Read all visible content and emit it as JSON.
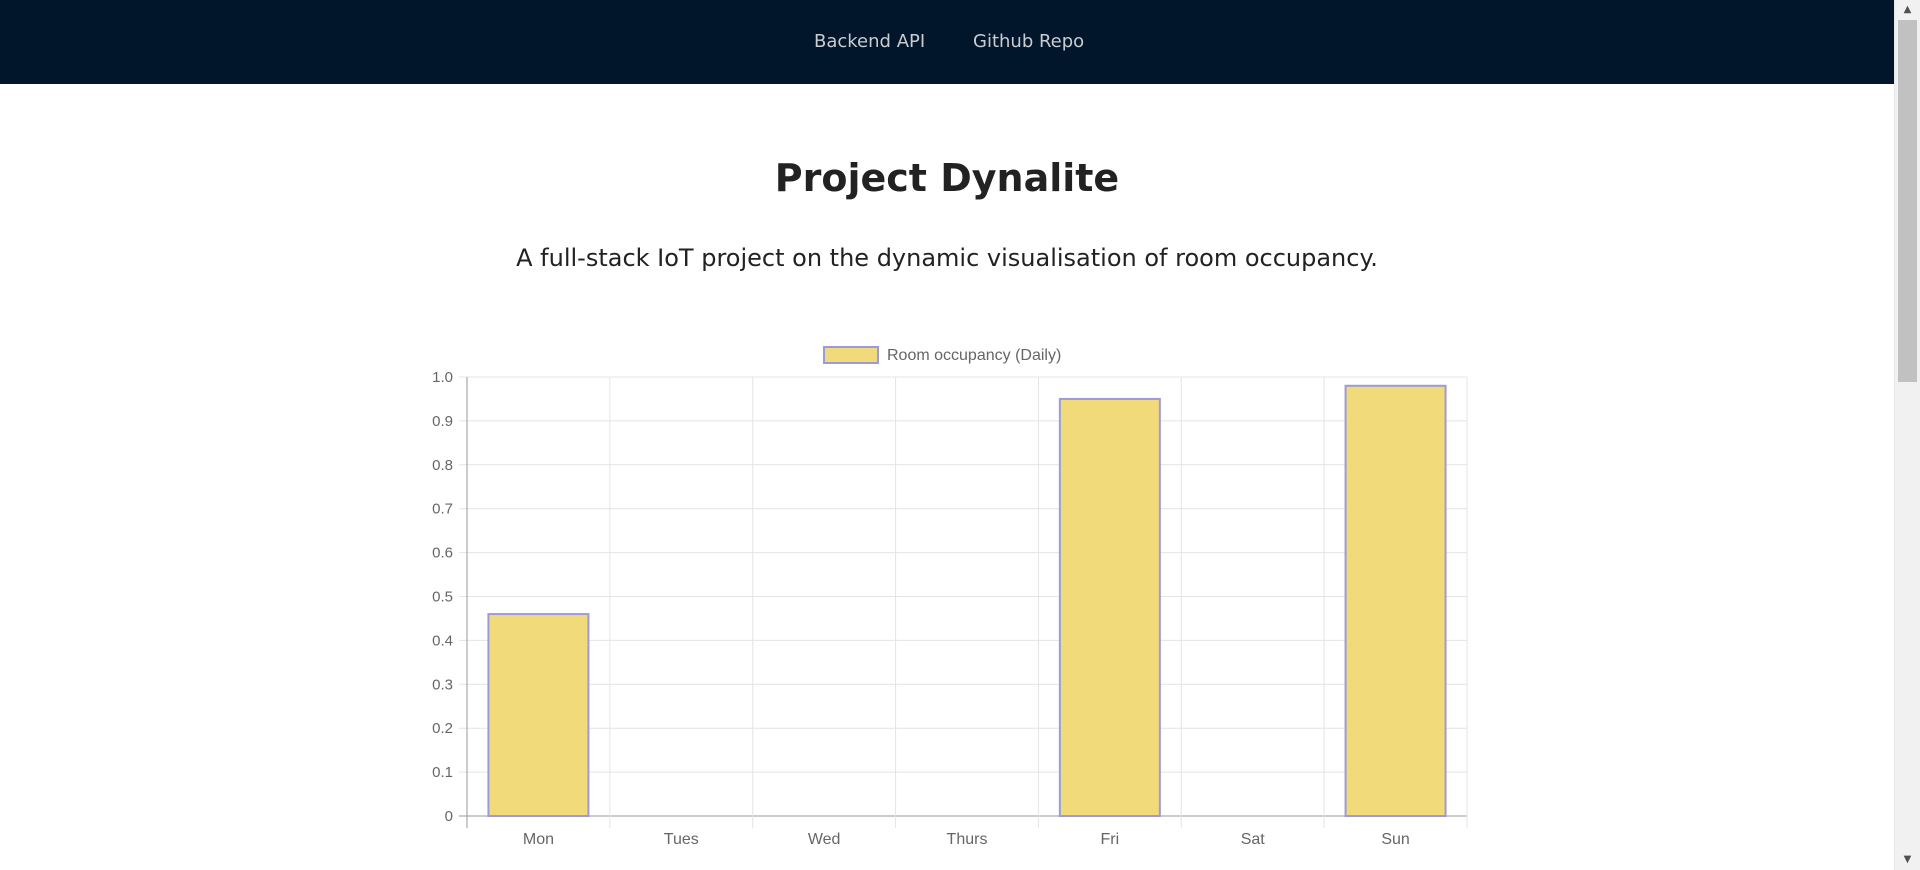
{
  "nav": {
    "links": [
      {
        "label": "Backend API"
      },
      {
        "label": "Github Repo"
      }
    ],
    "background": "#01152b"
  },
  "header": {
    "title": "Project Dynalite",
    "subtitle": "A full-stack IoT project on the dynamic visualisation of room occupancy."
  },
  "chart_data": {
    "type": "bar",
    "categories": [
      "Mon",
      "Tues",
      "Wed",
      "Thurs",
      "Fri",
      "Sat",
      "Sun"
    ],
    "series": [
      {
        "name": "Room occupancy (Daily)",
        "values": [
          0.46,
          0,
          0,
          0,
          0.95,
          0,
          0.98
        ]
      }
    ],
    "ylim": [
      0,
      1.0
    ],
    "yticks": [
      "0",
      "0.1",
      "0.2",
      "0.3",
      "0.4",
      "0.5",
      "0.6",
      "0.7",
      "0.8",
      "0.9",
      "1.0"
    ],
    "grid": true,
    "legend": "top-center",
    "bar_fill": "#f1da7a",
    "bar_border": "#9c9ad8"
  },
  "scrollbar": {
    "up_icon": "chevron-up-icon",
    "down_icon": "chevron-down-icon"
  }
}
